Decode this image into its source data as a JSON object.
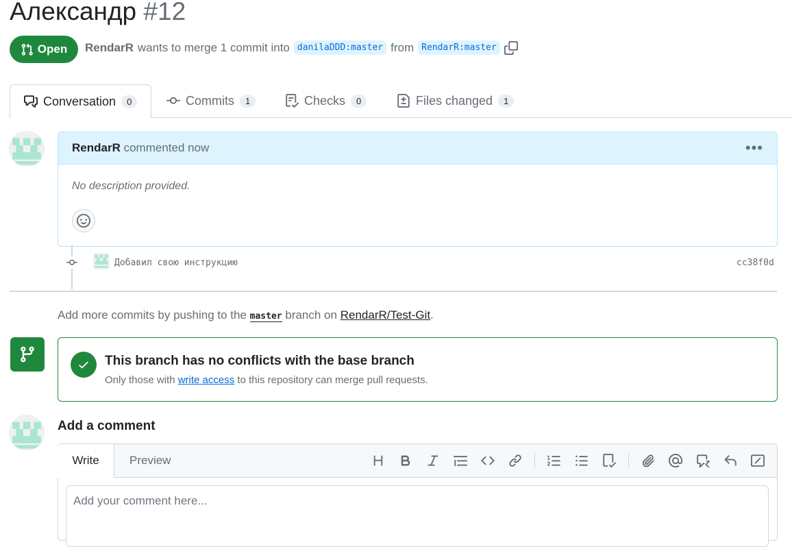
{
  "pr": {
    "title": "Александр",
    "number": "#12",
    "state": "Open",
    "author": "RendarR",
    "merge_text": "wants to merge 1 commit into",
    "base_branch": "danilaDDD:master",
    "from_text": "from",
    "head_branch": "RendarR:master"
  },
  "tabs": [
    {
      "label": "Conversation",
      "count": "0",
      "icon": "comment-discussion-icon"
    },
    {
      "label": "Commits",
      "count": "1",
      "icon": "git-commit-icon"
    },
    {
      "label": "Checks",
      "count": "0",
      "icon": "checklist-icon"
    },
    {
      "label": "Files changed",
      "count": "1",
      "icon": "file-diff-icon"
    }
  ],
  "comment": {
    "author": "RendarR",
    "action": "commented now",
    "body": "No description provided."
  },
  "commit": {
    "message": "Добавил свою инструкцию",
    "sha": "cc38f0d"
  },
  "push_hint": {
    "prefix": "Add more commits by pushing to the",
    "branch": "master",
    "middle": "branch on",
    "repo": "RendarR/Test-Git",
    "suffix": "."
  },
  "merge": {
    "title": "This branch has no conflicts with the base branch",
    "sub_prefix": "Only those with",
    "sub_link": "write access",
    "sub_suffix": "to this repository can merge pull requests."
  },
  "add_comment": {
    "title": "Add a comment",
    "tab_write": "Write",
    "tab_preview": "Preview",
    "placeholder": "Add your comment here..."
  },
  "colors": {
    "open_green": "#1f883d",
    "link_blue": "#0969da",
    "comment_header": "#ddf4ff",
    "avatar_mint": "#a8e6cf"
  }
}
